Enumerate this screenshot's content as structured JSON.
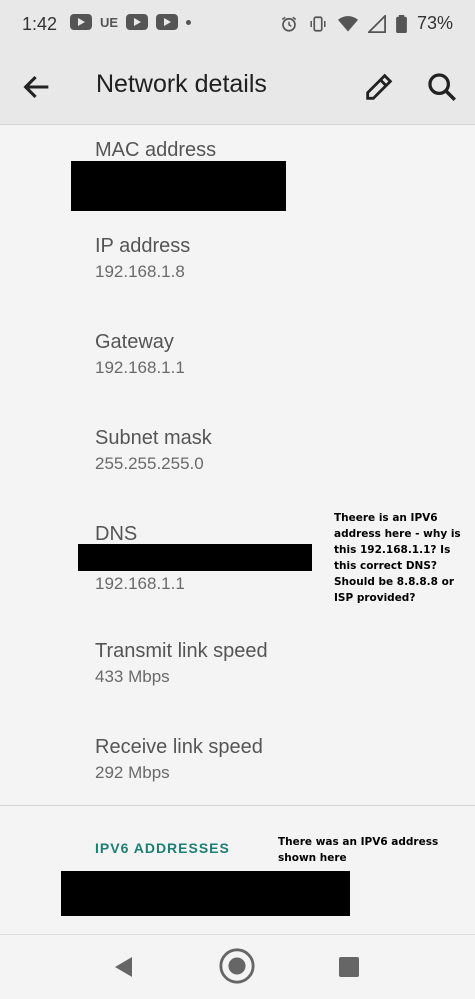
{
  "status_bar": {
    "time": "1:42",
    "left_icons": [
      "youtube-icon",
      "ue-label",
      "youtube-icon",
      "youtube-icon",
      "dot"
    ],
    "ue_text": "UE",
    "right_icons": [
      "alarm-icon",
      "vibrate-icon",
      "wifi-icon",
      "signal-icon",
      "battery-icon"
    ],
    "battery_percent": "73%"
  },
  "app_bar": {
    "title": "Network details",
    "back_icon": "arrow-back-icon",
    "edit_icon": "pencil-icon",
    "search_icon": "search-icon"
  },
  "details": [
    {
      "label": "MAC address",
      "value": ""
    },
    {
      "label": "IP address",
      "value": "192.168.1.8"
    },
    {
      "label": "Gateway",
      "value": "192.168.1.1"
    },
    {
      "label": "Subnet mask",
      "value": "255.255.255.0"
    },
    {
      "label": "DNS",
      "value": "192.168.1.1"
    },
    {
      "label": "Transmit link speed",
      "value": "433 Mbps"
    },
    {
      "label": "Receive link speed",
      "value": "292 Mbps"
    }
  ],
  "annotations": {
    "dns_note": "Theere is an IPV6 address here - why is this 192.168.1.1?  Is this correct DNS? Should be 8.8.8.8 or ISP provided?",
    "ipv6_note": "There was an IPV6 address shown here"
  },
  "ipv6_section": {
    "header": "IPV6 ADDRESSES"
  },
  "nav_bar": {
    "icons": [
      "nav-back-icon",
      "nav-home-icon",
      "nav-recents-icon"
    ]
  },
  "colors": {
    "accent": "#1b7f74",
    "bar_background": "#e8e8e8",
    "page_background": "#f4f4f4"
  }
}
